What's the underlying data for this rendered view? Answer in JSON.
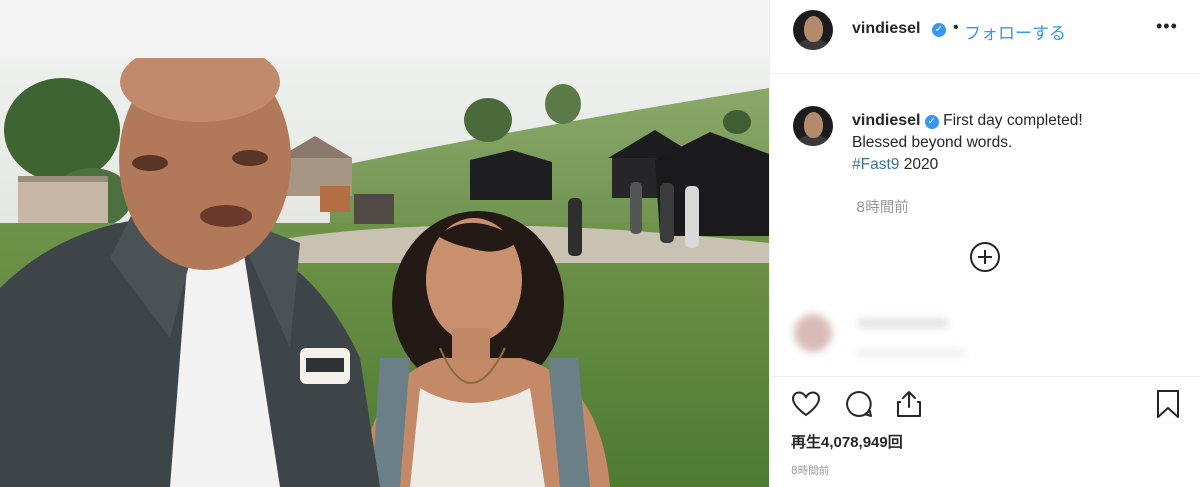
{
  "post": {
    "username": "vindiesel",
    "verified_mark": "✓",
    "separator": "•",
    "follow_label": "フォローする",
    "more_label": "•••"
  },
  "caption": {
    "username": "vindiesel",
    "line1": "First day completed!",
    "line2": "Blessed beyond words.",
    "hashtag": "#Fast9",
    "year": "2020",
    "posted_ago": "8時間前"
  },
  "actions": {
    "icons": [
      "heart-icon",
      "comment-icon",
      "share-icon",
      "bookmark-icon"
    ],
    "views_label": "再生",
    "views_count": "4,078,949",
    "views_suffix": "回",
    "timestamp": "8時間前"
  },
  "colors": {
    "link_blue": "#3897f0",
    "hashtag_blue": "#3f729b",
    "text": "#262626",
    "muted": "#999999",
    "border": "#efefef"
  }
}
